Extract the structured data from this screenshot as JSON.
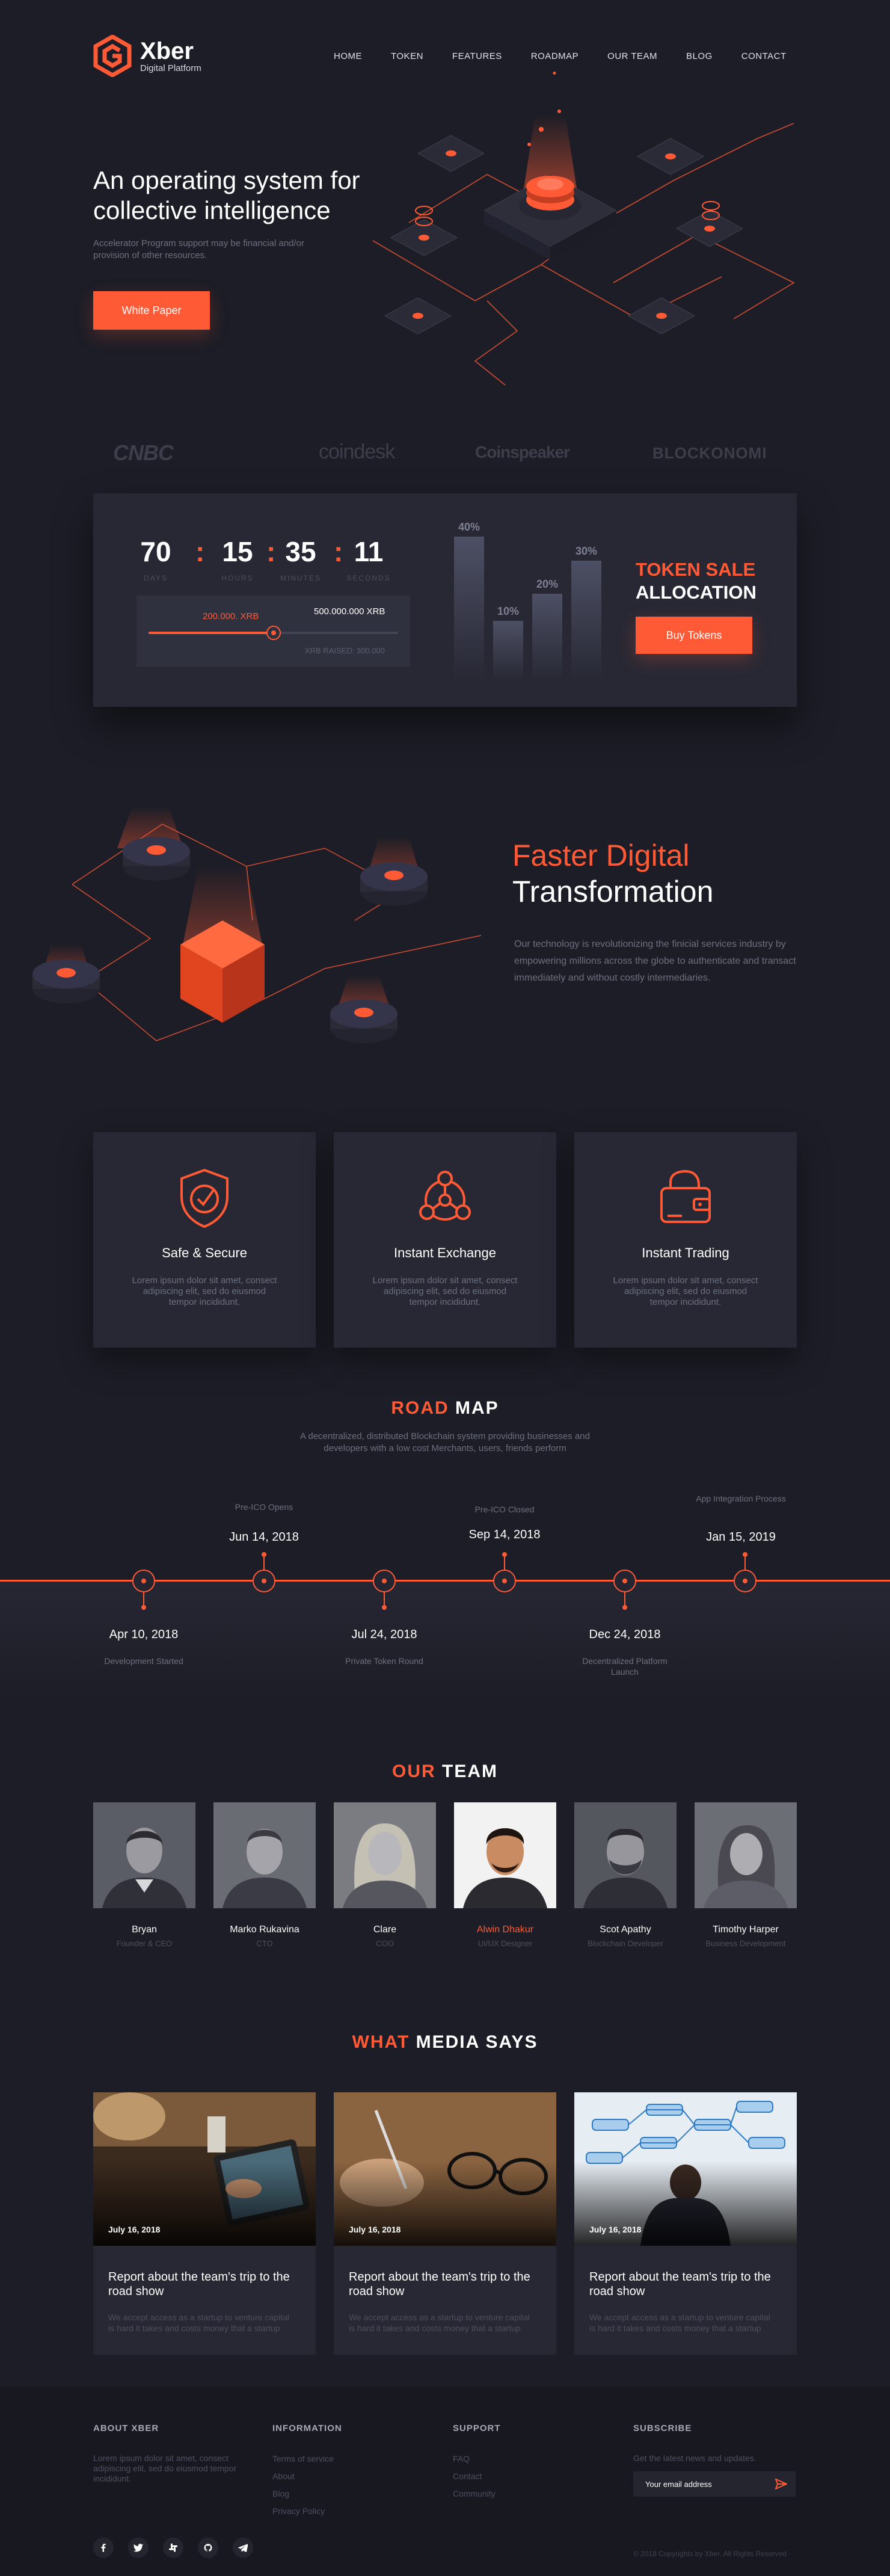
{
  "brand": {
    "name": "Xber",
    "tagline": "Digital Platform",
    "accent": "#ff5a36"
  },
  "nav": [
    "HOME",
    "TOKEN",
    "FEATURES",
    "ROADMAP",
    "OUR TEAM",
    "BLOG",
    "CONTACT"
  ],
  "nav_active": "ROADMAP",
  "hero": {
    "title": "An operating system for collective intelligence",
    "subtitle": "Accelerator Program support may be financial and/or provision of other resources.",
    "button": "White Paper"
  },
  "press": [
    "CNBC",
    "coindesk",
    "Coinspeaker",
    "BLOCKONOMI"
  ],
  "token_sale": {
    "countdown": [
      {
        "value": "70",
        "label": "DAYS"
      },
      {
        "value": "15",
        "label": "HOURS"
      },
      {
        "value": "35",
        "label": "MINUTES"
      },
      {
        "value": "11",
        "label": "SECONDS"
      }
    ],
    "raised": "200.000. XRB",
    "goal": "500.000.000 XRB",
    "raised_note": "XRB RAISED: 300.000",
    "raised_fraction": 0.5,
    "allocation": [
      {
        "label": "40%",
        "value": 40
      },
      {
        "label": "10%",
        "value": 10
      },
      {
        "label": "20%",
        "value": 20
      },
      {
        "label": "30%",
        "value": 30
      }
    ],
    "title_line1": "TOKEN SALE",
    "title_line2": "ALLOCATION",
    "button": "Buy Tokens"
  },
  "transformation": {
    "title_line1": "Faster Digital",
    "title_line2": "Transformation",
    "text": "Our technology is revolutionizing the finicial services industry by empowering millions across the globe to authenticate and transact immediately and without costly intermediaries."
  },
  "features": [
    {
      "icon": "shield-check-icon",
      "title": "Safe & Secure",
      "text": "Lorem ipsum dolor sit amet, consect adipiscing elit, sed do eiusmod tempor incididunt."
    },
    {
      "icon": "exchange-network-icon",
      "title": "Instant Exchange",
      "text": "Lorem ipsum dolor sit amet, consect adipiscing elit, sed do eiusmod tempor incididunt."
    },
    {
      "icon": "wallet-icon",
      "title": "Instant Trading",
      "text": "Lorem ipsum dolor sit amet, consect adipiscing elit, sed do eiusmod tempor incididunt."
    }
  ],
  "roadmap": {
    "title_accent": "ROAD",
    "title_rest": "MAP",
    "subtitle": "A decentralized, distributed Blockchain system providing businesses and developers with a low cost Merchants, users, friends perform",
    "milestones": [
      {
        "date": "Apr 10, 2018",
        "label": "Development Started",
        "position": "below"
      },
      {
        "date": "Jun 14, 2018",
        "label": "Pre-ICO Opens",
        "position": "above"
      },
      {
        "date": "Jul 24, 2018",
        "label": "Private Token Round",
        "position": "below"
      },
      {
        "date": "Sep 14, 2018",
        "label": "Pre-ICO Closed",
        "position": "above"
      },
      {
        "date": "Dec 24, 2018",
        "label": "Decentralized Platform Launch",
        "position": "below"
      },
      {
        "date": "Jan 15, 2019",
        "label": "App Integration Process",
        "position": "above"
      }
    ]
  },
  "team": {
    "title_accent": "OUR",
    "title_rest": "TEAM",
    "members": [
      {
        "name": "Bryan",
        "role": "Founder & CEO"
      },
      {
        "name": "Marko Rukavina",
        "role": "CTO"
      },
      {
        "name": "Clare",
        "role": "COO"
      },
      {
        "name": "Alwin Dhakur",
        "role": "UI/UX Designer"
      },
      {
        "name": "Scot Apathy",
        "role": "Blockchain Developer"
      },
      {
        "name": "Timothy Harper",
        "role": "Business Development"
      }
    ]
  },
  "media": {
    "title_accent": "WHAT",
    "title_rest": "MEDIA SAYS",
    "posts": [
      {
        "date": "July 16, 2018",
        "title": "Report about the team's trip to the road show",
        "text": "We accept access as a startup to venture capital is hard it takes and costs money that a startup"
      },
      {
        "date": "July 16, 2018",
        "title": "Report about the team's trip to the road show",
        "text": "We accept access as a startup to venture capital is hard it takes and costs money that a startup"
      },
      {
        "date": "July 16, 2018",
        "title": "Report about the team's trip to the road show",
        "text": "We accept access as a startup to venture capital is hard it takes and costs money that a startup"
      }
    ]
  },
  "footer": {
    "about": {
      "heading": "ABOUT XBER",
      "text": "Lorem ipsum dolor sit amet, consect adipiscing elit, sed do eiusmod tempor incididunt."
    },
    "information": {
      "heading": "INFORMATION",
      "links": [
        "Terms of service",
        "About",
        "Blog",
        "Privacy Policy"
      ]
    },
    "support": {
      "heading": "SUPPORT",
      "links": [
        "FAQ",
        "Contact",
        "Community"
      ]
    },
    "subscribe": {
      "heading": "SUBSCRIBE",
      "text": "Get the latest news and updates.",
      "placeholder": "Your email address"
    },
    "social": [
      "facebook-icon",
      "twitter-icon",
      "slack-icon",
      "github-icon",
      "telegram-icon"
    ],
    "copyright": "© 2018 Copyrights by Xber. All Rights Reserved"
  }
}
